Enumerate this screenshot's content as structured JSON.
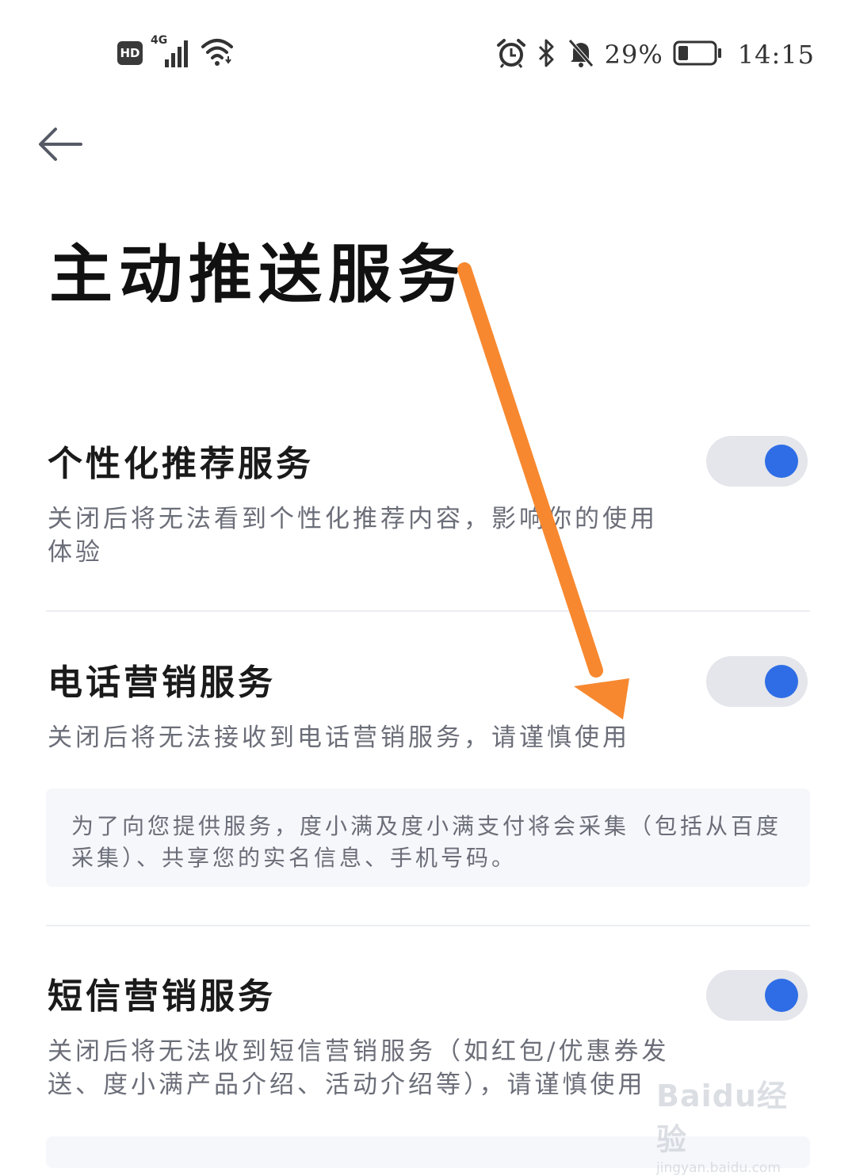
{
  "status_bar": {
    "hd_label": "HD",
    "network_label": "4G",
    "battery_text": "29%",
    "time": "14:15",
    "battery_level": 0.29
  },
  "header": {
    "title": "主动推送服务"
  },
  "settings": [
    {
      "title": "个性化推荐服务",
      "description": "关闭后将无法看到个性化推荐内容，影响你的使用体验",
      "enabled": true
    },
    {
      "title": "电话营销服务",
      "description": "关闭后将无法接收到电话营销服务，请谨慎使用",
      "enabled": true,
      "notice": "为了向您提供服务，度小满及度小满支付将会采集（包括从百度采集）、共享您的实名信息、手机号码。"
    },
    {
      "title": "短信营销服务",
      "description": "关闭后将无法收到短信营销服务（如红包/优惠券发送、度小满产品介绍、活动介绍等），请谨慎使用",
      "enabled": true
    }
  ],
  "watermark": {
    "brand": "Baidu经验",
    "url": "jingyan.baidu.com"
  },
  "colors": {
    "accent": "#2f6de6",
    "annotation_arrow": "#f7882f",
    "toggle_track": "#e4e6eb",
    "notice_bg": "#f6f7fb"
  }
}
